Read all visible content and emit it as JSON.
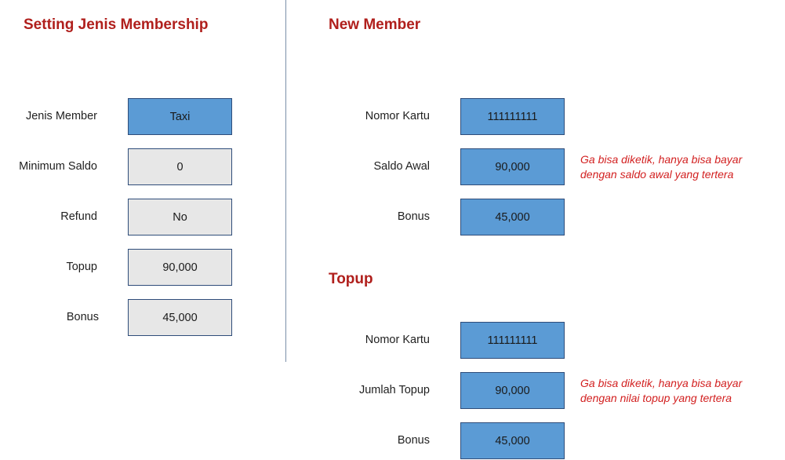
{
  "setting": {
    "title": "Setting Jenis Membership",
    "fields": [
      {
        "label": "Jenis Member",
        "value": "Taxi"
      },
      {
        "label": "Minimum  Saldo",
        "value": "0"
      },
      {
        "label": "Refund",
        "value": "No"
      },
      {
        "label": "Topup",
        "value": "90,000"
      },
      {
        "label": "Bonus",
        "value": "45,000"
      }
    ]
  },
  "new_member": {
    "title": "New Member",
    "fields": [
      {
        "label": "Nomor  Kartu",
        "value": "111111111"
      },
      {
        "label": "Saldo  Awal",
        "value": "90,000"
      },
      {
        "label": "Bonus",
        "value": "45,000"
      }
    ],
    "note": [
      "Ga bisa diketik, hanya bisa bayar",
      "dengan saldo awal yang tertera"
    ]
  },
  "topup": {
    "title": "Topup",
    "fields": [
      {
        "label": "Nomor  Kartu",
        "value": "111111111"
      },
      {
        "label": "Jumlah  Topup",
        "value": "90,000"
      },
      {
        "label": "Bonus",
        "value": "45,000"
      }
    ],
    "note": [
      "Ga bisa diketik, hanya bisa bayar",
      "dengan nilai topup yang tertera"
    ]
  },
  "colors": {
    "heading": "#b01f1c",
    "field_blue": "#5b9bd5",
    "field_gray": "#e7e7e7",
    "note": "#d21f1f"
  }
}
